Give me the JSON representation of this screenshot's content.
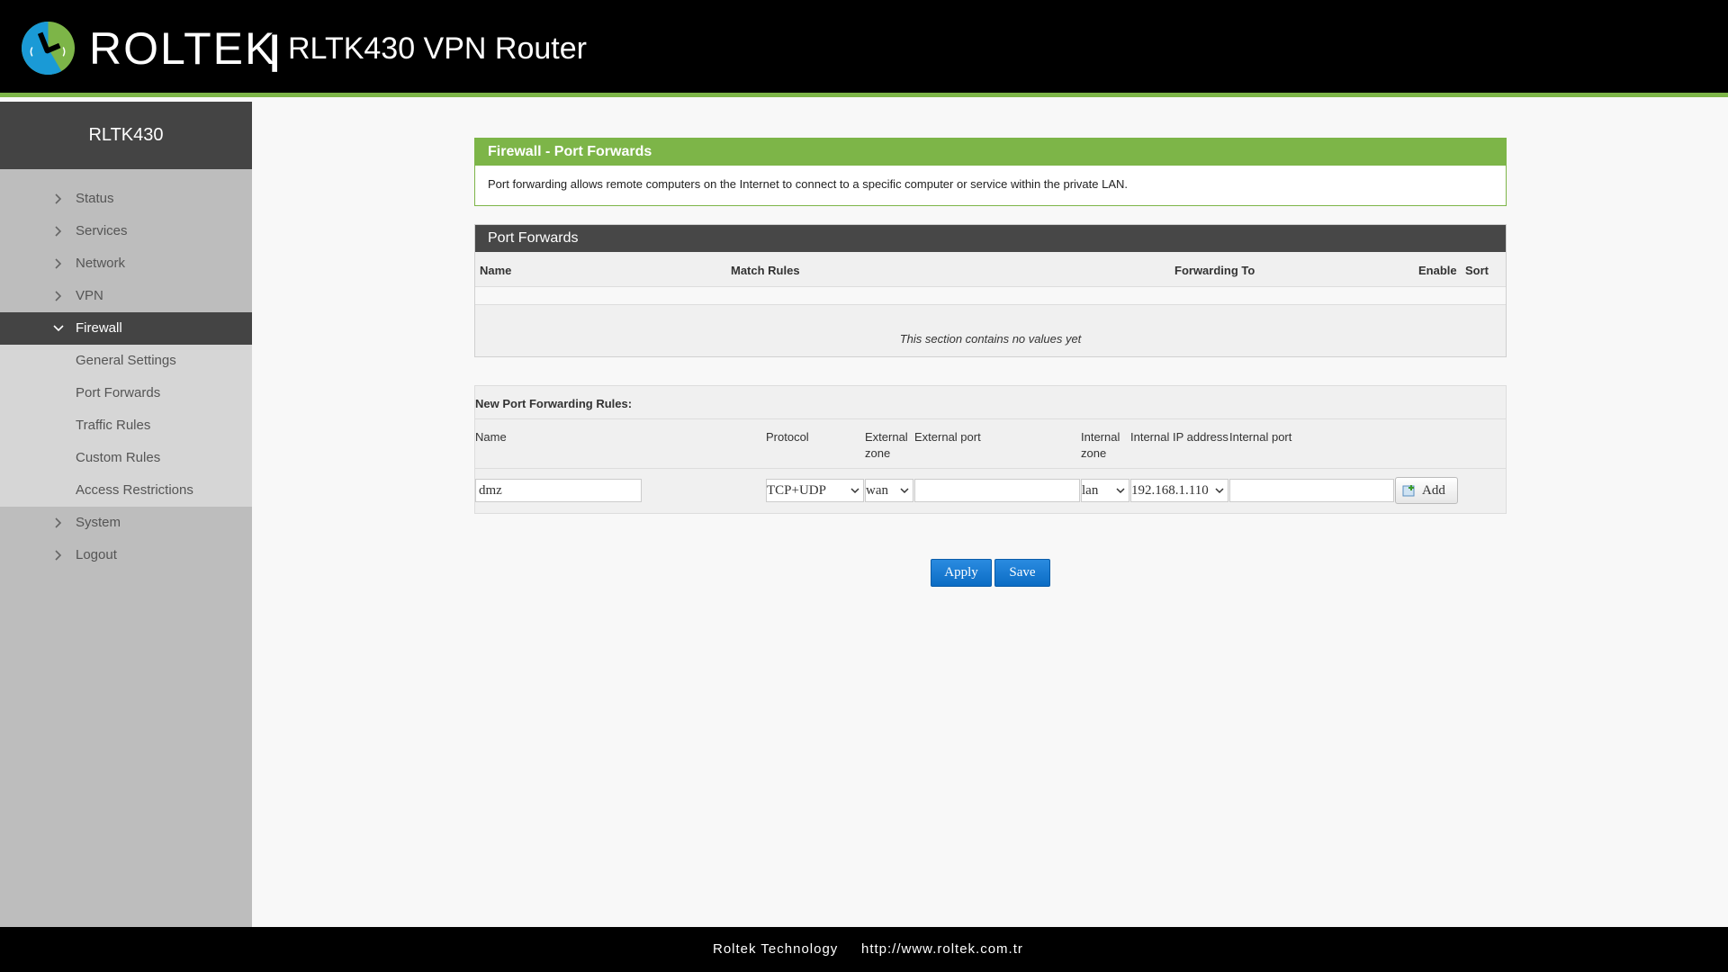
{
  "header": {
    "brand": "ROLTEK",
    "separator": "|",
    "product": "RLTK430 VPN Router",
    "accent": "#7db548"
  },
  "sidebar": {
    "title": "RLTK430",
    "items": [
      {
        "label": "Status",
        "icon": "chevron-right-icon"
      },
      {
        "label": "Services",
        "icon": "chevron-right-icon"
      },
      {
        "label": "Network",
        "icon": "chevron-right-icon"
      },
      {
        "label": "VPN",
        "icon": "chevron-right-icon"
      },
      {
        "label": "Firewall",
        "icon": "chevron-down-icon",
        "active": true
      },
      {
        "label": "System",
        "icon": "chevron-right-icon"
      },
      {
        "label": "Logout",
        "icon": "chevron-right-icon"
      }
    ],
    "firewall_sub": [
      {
        "label": "General Settings"
      },
      {
        "label": "Port Forwards"
      },
      {
        "label": "Traffic Rules"
      },
      {
        "label": "Custom Rules"
      },
      {
        "label": "Access Restrictions"
      }
    ]
  },
  "info": {
    "title": "Firewall - Port Forwards",
    "description": "Port forwarding allows remote computers on the Internet to connect to a specific computer or service within the private LAN."
  },
  "port_forwards": {
    "title": "Port Forwards",
    "columns": [
      "Name",
      "Match Rules",
      "Forwarding To",
      "Enable",
      "Sort"
    ],
    "empty_text": "This section contains no values yet"
  },
  "new_rule": {
    "title": "New Port Forwarding Rules:",
    "labels": {
      "name": "Name",
      "protocol": "Protocol",
      "ext_zone_1": "External",
      "ext_zone_2": "zone",
      "ext_port": "External port",
      "int_zone_1": "Internal",
      "int_zone_2": "zone",
      "int_ip": "Internal IP address",
      "int_port": "Internal port"
    },
    "values": {
      "name": "dmz",
      "protocol": "TCP+UDP",
      "ext_zone": "wan",
      "ext_port": "",
      "int_zone": "lan",
      "int_ip": "192.168.1.110",
      "int_port": ""
    },
    "add_label": "Add"
  },
  "actions": {
    "apply": "Apply",
    "save": "Save"
  },
  "footer": {
    "company": "Roltek Technology",
    "url": "http://www.roltek.com.tr"
  }
}
